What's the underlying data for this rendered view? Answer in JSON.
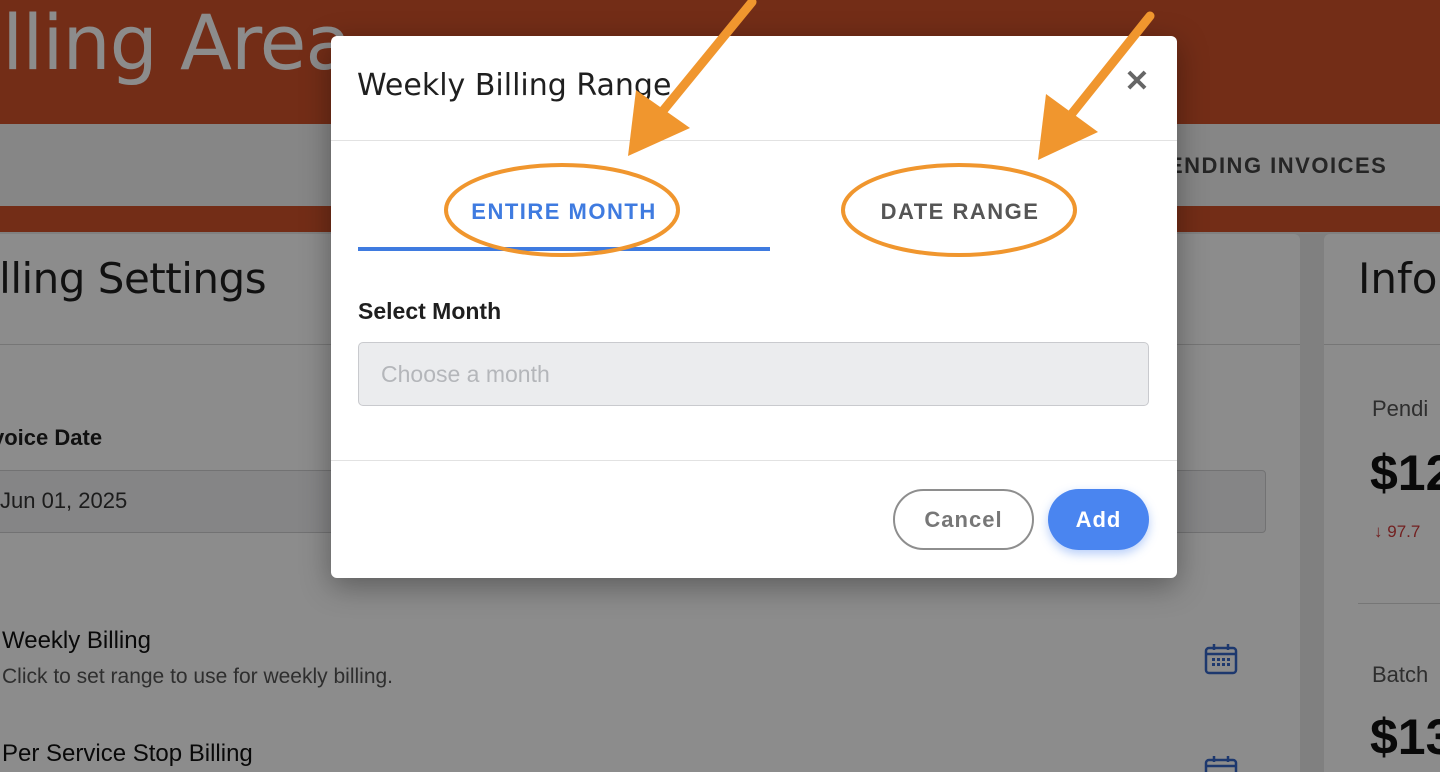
{
  "page": {
    "header_title": "illing Area",
    "tab_visible": "ENDING INVOICES"
  },
  "settings_card": {
    "title": "illing Settings",
    "invoice_date_label": "voice Date",
    "invoice_date_value": "Jun 01, 2025",
    "items": [
      {
        "title": "Weekly Billing",
        "description": "Click to set range to use for weekly billing.",
        "icon": "calendar-icon"
      },
      {
        "title": "Per Service Stop Billing",
        "description": "",
        "icon": "calendar-icon"
      }
    ]
  },
  "info_card": {
    "title": "Info",
    "pending_label": "Pendi",
    "pending_amount": "$12",
    "pending_change": "97.7",
    "batch_label": "Batch",
    "batch_amount": "$13"
  },
  "modal": {
    "title": "Weekly Billing Range",
    "close_icon": "close-icon",
    "tabs": [
      {
        "label": "ENTIRE MONTH",
        "active": true
      },
      {
        "label": "DATE RANGE",
        "active": false
      }
    ],
    "select_month_label": "Select Month",
    "month_input": {
      "placeholder": "Choose a month",
      "value": ""
    },
    "cancel_label": "Cancel",
    "add_label": "Add"
  },
  "colors": {
    "brand_orange": "#d2532a",
    "accent_blue": "#3f7be0",
    "add_button": "#4a85f0",
    "annotation_orange": "#f0962e",
    "negative_red": "#d03b3b"
  }
}
